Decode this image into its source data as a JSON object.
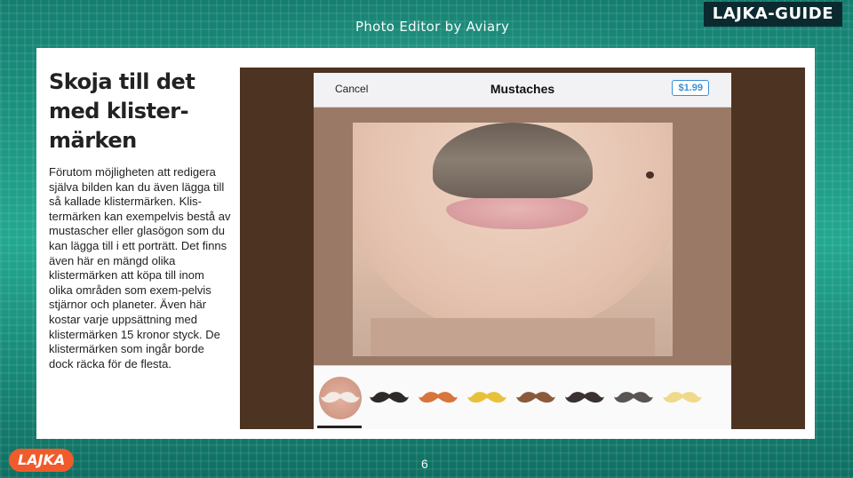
{
  "header": {
    "title": "Photo Editor by Aviary",
    "badge": "LAJKA-GUIDE"
  },
  "article": {
    "heading": "Skoja till det med klister-märken",
    "body": "Förutom möjligheten att redigera själva bilden kan du även lägga till så kallade klistermärken. Klis-termärken kan exempelvis bestå av mustascher eller glasögon som du kan lägga till i ett porträtt. Det finns även här en mängd olika klistermärken att köpa till inom olika områden som exem-pelvis stjärnor och planeter. Även här kostar varje uppsättning med klistermärken 15 kronor styck. De klistermärken som ingår borde dock räcka för de flesta."
  },
  "editor": {
    "cancel_label": "Cancel",
    "title": "Mustaches",
    "price": "$1.99",
    "stickers": [
      {
        "name": "white-mustache-icon",
        "color": "#f2ebe6",
        "selected": true
      },
      {
        "name": "black-handlebar-mustache-icon",
        "color": "#2e2a28",
        "selected": false
      },
      {
        "name": "orange-mustache-icon",
        "color": "#d8753a",
        "selected": false
      },
      {
        "name": "yellow-mustache-icon",
        "color": "#e8c13a",
        "selected": false
      },
      {
        "name": "brown-curly-mustache-icon",
        "color": "#8a5a3a",
        "selected": false
      },
      {
        "name": "dark-bushy-mustache-icon",
        "color": "#3a3230",
        "selected": false
      },
      {
        "name": "gray-mustache-icon",
        "color": "#5a5552",
        "selected": false
      },
      {
        "name": "blonde-mustache-icon",
        "color": "#f0d98a",
        "selected": false
      }
    ]
  },
  "footer": {
    "logo": "LAJKA",
    "page_number": "6"
  }
}
